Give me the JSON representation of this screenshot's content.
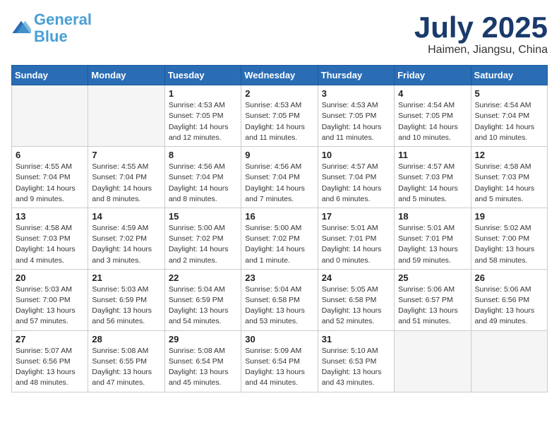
{
  "header": {
    "logo_line1": "General",
    "logo_line2": "Blue",
    "month_year": "July 2025",
    "location": "Haimen, Jiangsu, China"
  },
  "days_of_week": [
    "Sunday",
    "Monday",
    "Tuesday",
    "Wednesday",
    "Thursday",
    "Friday",
    "Saturday"
  ],
  "weeks": [
    [
      {
        "day": "",
        "info": ""
      },
      {
        "day": "",
        "info": ""
      },
      {
        "day": "1",
        "info": "Sunrise: 4:53 AM\nSunset: 7:05 PM\nDaylight: 14 hours\nand 12 minutes."
      },
      {
        "day": "2",
        "info": "Sunrise: 4:53 AM\nSunset: 7:05 PM\nDaylight: 14 hours\nand 11 minutes."
      },
      {
        "day": "3",
        "info": "Sunrise: 4:53 AM\nSunset: 7:05 PM\nDaylight: 14 hours\nand 11 minutes."
      },
      {
        "day": "4",
        "info": "Sunrise: 4:54 AM\nSunset: 7:05 PM\nDaylight: 14 hours\nand 10 minutes."
      },
      {
        "day": "5",
        "info": "Sunrise: 4:54 AM\nSunset: 7:04 PM\nDaylight: 14 hours\nand 10 minutes."
      }
    ],
    [
      {
        "day": "6",
        "info": "Sunrise: 4:55 AM\nSunset: 7:04 PM\nDaylight: 14 hours\nand 9 minutes."
      },
      {
        "day": "7",
        "info": "Sunrise: 4:55 AM\nSunset: 7:04 PM\nDaylight: 14 hours\nand 8 minutes."
      },
      {
        "day": "8",
        "info": "Sunrise: 4:56 AM\nSunset: 7:04 PM\nDaylight: 14 hours\nand 8 minutes."
      },
      {
        "day": "9",
        "info": "Sunrise: 4:56 AM\nSunset: 7:04 PM\nDaylight: 14 hours\nand 7 minutes."
      },
      {
        "day": "10",
        "info": "Sunrise: 4:57 AM\nSunset: 7:04 PM\nDaylight: 14 hours\nand 6 minutes."
      },
      {
        "day": "11",
        "info": "Sunrise: 4:57 AM\nSunset: 7:03 PM\nDaylight: 14 hours\nand 5 minutes."
      },
      {
        "day": "12",
        "info": "Sunrise: 4:58 AM\nSunset: 7:03 PM\nDaylight: 14 hours\nand 5 minutes."
      }
    ],
    [
      {
        "day": "13",
        "info": "Sunrise: 4:58 AM\nSunset: 7:03 PM\nDaylight: 14 hours\nand 4 minutes."
      },
      {
        "day": "14",
        "info": "Sunrise: 4:59 AM\nSunset: 7:02 PM\nDaylight: 14 hours\nand 3 minutes."
      },
      {
        "day": "15",
        "info": "Sunrise: 5:00 AM\nSunset: 7:02 PM\nDaylight: 14 hours\nand 2 minutes."
      },
      {
        "day": "16",
        "info": "Sunrise: 5:00 AM\nSunset: 7:02 PM\nDaylight: 14 hours\nand 1 minute."
      },
      {
        "day": "17",
        "info": "Sunrise: 5:01 AM\nSunset: 7:01 PM\nDaylight: 14 hours\nand 0 minutes."
      },
      {
        "day": "18",
        "info": "Sunrise: 5:01 AM\nSunset: 7:01 PM\nDaylight: 13 hours\nand 59 minutes."
      },
      {
        "day": "19",
        "info": "Sunrise: 5:02 AM\nSunset: 7:00 PM\nDaylight: 13 hours\nand 58 minutes."
      }
    ],
    [
      {
        "day": "20",
        "info": "Sunrise: 5:03 AM\nSunset: 7:00 PM\nDaylight: 13 hours\nand 57 minutes."
      },
      {
        "day": "21",
        "info": "Sunrise: 5:03 AM\nSunset: 6:59 PM\nDaylight: 13 hours\nand 56 minutes."
      },
      {
        "day": "22",
        "info": "Sunrise: 5:04 AM\nSunset: 6:59 PM\nDaylight: 13 hours\nand 54 minutes."
      },
      {
        "day": "23",
        "info": "Sunrise: 5:04 AM\nSunset: 6:58 PM\nDaylight: 13 hours\nand 53 minutes."
      },
      {
        "day": "24",
        "info": "Sunrise: 5:05 AM\nSunset: 6:58 PM\nDaylight: 13 hours\nand 52 minutes."
      },
      {
        "day": "25",
        "info": "Sunrise: 5:06 AM\nSunset: 6:57 PM\nDaylight: 13 hours\nand 51 minutes."
      },
      {
        "day": "26",
        "info": "Sunrise: 5:06 AM\nSunset: 6:56 PM\nDaylight: 13 hours\nand 49 minutes."
      }
    ],
    [
      {
        "day": "27",
        "info": "Sunrise: 5:07 AM\nSunset: 6:56 PM\nDaylight: 13 hours\nand 48 minutes."
      },
      {
        "day": "28",
        "info": "Sunrise: 5:08 AM\nSunset: 6:55 PM\nDaylight: 13 hours\nand 47 minutes."
      },
      {
        "day": "29",
        "info": "Sunrise: 5:08 AM\nSunset: 6:54 PM\nDaylight: 13 hours\nand 45 minutes."
      },
      {
        "day": "30",
        "info": "Sunrise: 5:09 AM\nSunset: 6:54 PM\nDaylight: 13 hours\nand 44 minutes."
      },
      {
        "day": "31",
        "info": "Sunrise: 5:10 AM\nSunset: 6:53 PM\nDaylight: 13 hours\nand 43 minutes."
      },
      {
        "day": "",
        "info": ""
      },
      {
        "day": "",
        "info": ""
      }
    ]
  ]
}
